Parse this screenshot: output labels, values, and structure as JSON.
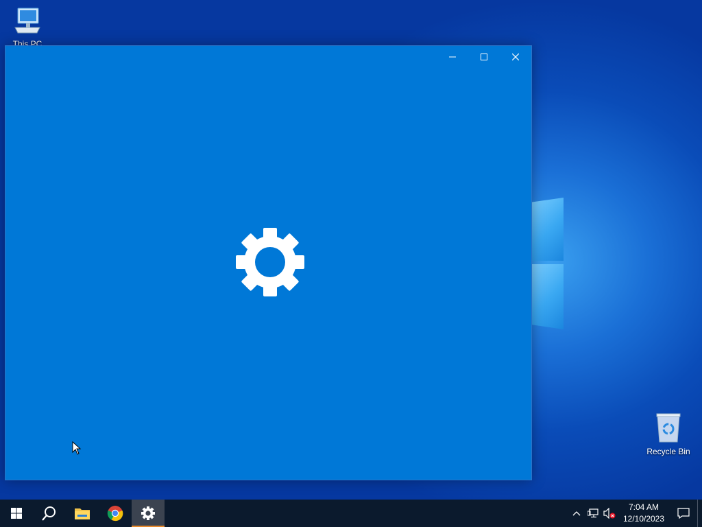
{
  "desktop": {
    "icons": [
      {
        "label": "This PC"
      },
      {
        "label": "Recycle Bin"
      }
    ]
  },
  "settings_window": {
    "splash_icon": "gear-icon",
    "background_color": "#0078d7",
    "controls": {
      "minimize": "minimize-icon",
      "maximize": "maximize-icon",
      "close": "close-icon"
    }
  },
  "taskbar": {
    "apps": [
      {
        "name": "start",
        "icon": "windows-logo-icon"
      },
      {
        "name": "search",
        "icon": "search-icon"
      },
      {
        "name": "file-explorer",
        "icon": "folder-icon"
      },
      {
        "name": "chrome",
        "icon": "chrome-icon"
      },
      {
        "name": "settings",
        "icon": "gear-icon",
        "active": true
      }
    ],
    "tray": {
      "icons": [
        "chevron-up-icon",
        "network-icon",
        "volume-muted-icon"
      ],
      "time": "7:04 AM",
      "date": "12/10/2023"
    },
    "accent_color": "#e88a2c"
  }
}
